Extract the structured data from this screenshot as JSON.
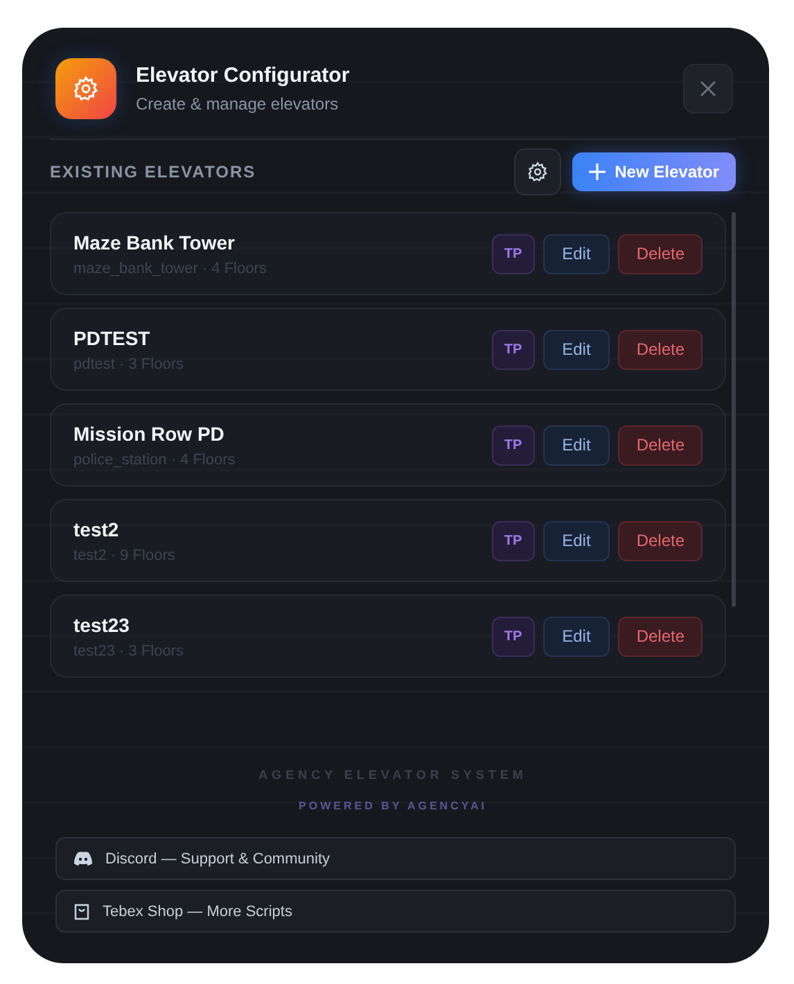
{
  "header": {
    "title": "Elevator Configurator",
    "subtitle": "Create & manage elevators"
  },
  "section": {
    "title": "EXISTING ELEVATORS",
    "new_button": "New Elevator"
  },
  "elevators": [
    {
      "name": "Maze Bank Tower",
      "meta": "maze_bank_tower · 4 Floors",
      "tp": "TP",
      "edit": "Edit",
      "delete": "Delete"
    },
    {
      "name": "PDTEST",
      "meta": "pdtest · 3 Floors",
      "tp": "TP",
      "edit": "Edit",
      "delete": "Delete"
    },
    {
      "name": "Mission Row PD",
      "meta": "police_station · 4 Floors",
      "tp": "TP",
      "edit": "Edit",
      "delete": "Delete"
    },
    {
      "name": "test2",
      "meta": "test2 · 9 Floors",
      "tp": "TP",
      "edit": "Edit",
      "delete": "Delete"
    },
    {
      "name": "test23",
      "meta": "test23 · 3 Floors",
      "tp": "TP",
      "edit": "Edit",
      "delete": "Delete"
    }
  ],
  "footer": {
    "title": "AGENCY ELEVATOR SYSTEM",
    "powered": "POWERED BY AGENCYAI"
  },
  "links": [
    {
      "kind": "discord",
      "label": "Discord — Support & Community"
    },
    {
      "kind": "shop",
      "label": "Tebex Shop — More Scripts"
    }
  ]
}
